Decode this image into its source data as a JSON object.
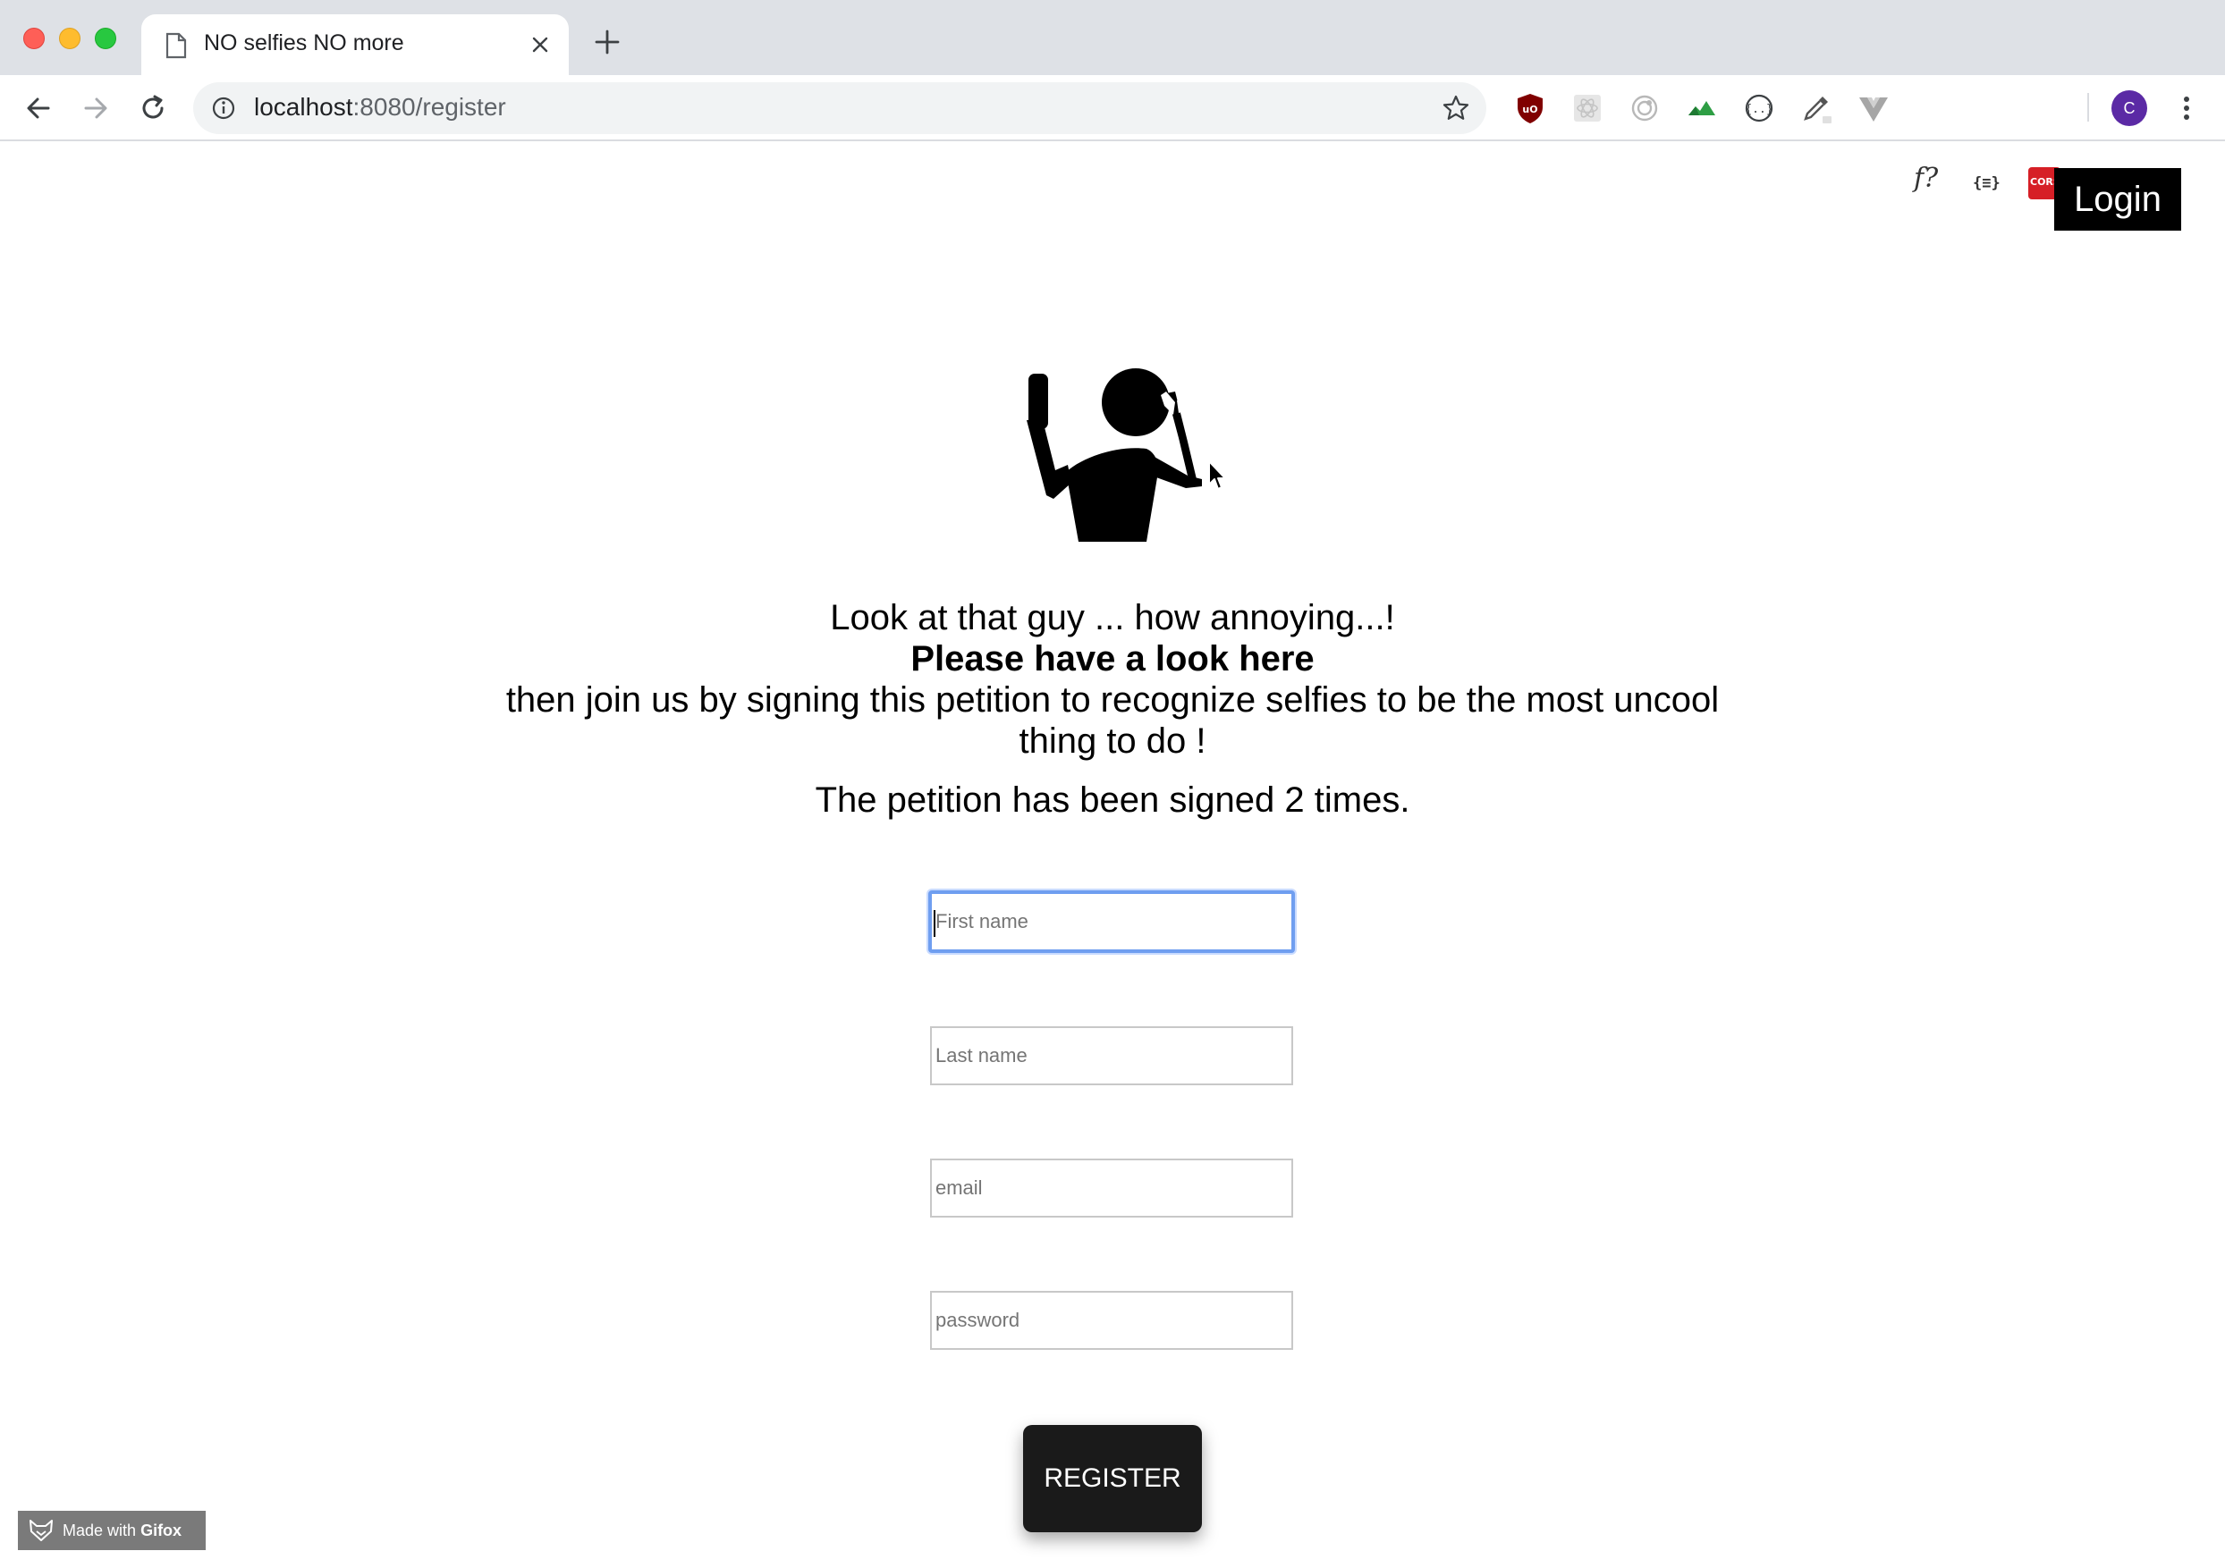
{
  "browser": {
    "tab_title": "NO selfies NO more",
    "url_host": "localhost",
    "url_path": ":8080/register",
    "avatar_letter": "C",
    "ext_func_label": "f?",
    "ext_json_label": "{≡}",
    "ext_cors_label": "CORS"
  },
  "header": {
    "login_label": "Login"
  },
  "intro": {
    "line1": "Look at that guy ... how annoying...!",
    "line2": "Please have a look here",
    "line3": "then join us by signing this petition to recognize selfies to be the most uncool thing to do !"
  },
  "petition": {
    "count_text": "The petition has been signed 2 times."
  },
  "form": {
    "first_name_placeholder": "First name",
    "last_name_placeholder": "Last name",
    "email_placeholder": "email",
    "password_placeholder": "password",
    "register_label": "REGISTER"
  },
  "watermark": {
    "prefix": "Made with",
    "brand": "Gifox"
  },
  "colors": {
    "focus_ring": "#6f9ef0",
    "button_bg": "#1a1a1a",
    "login_bg": "#000000",
    "avatar_bg": "#5b2aa5",
    "ublock_red": "#800000",
    "cors_red": "#d61f26"
  }
}
